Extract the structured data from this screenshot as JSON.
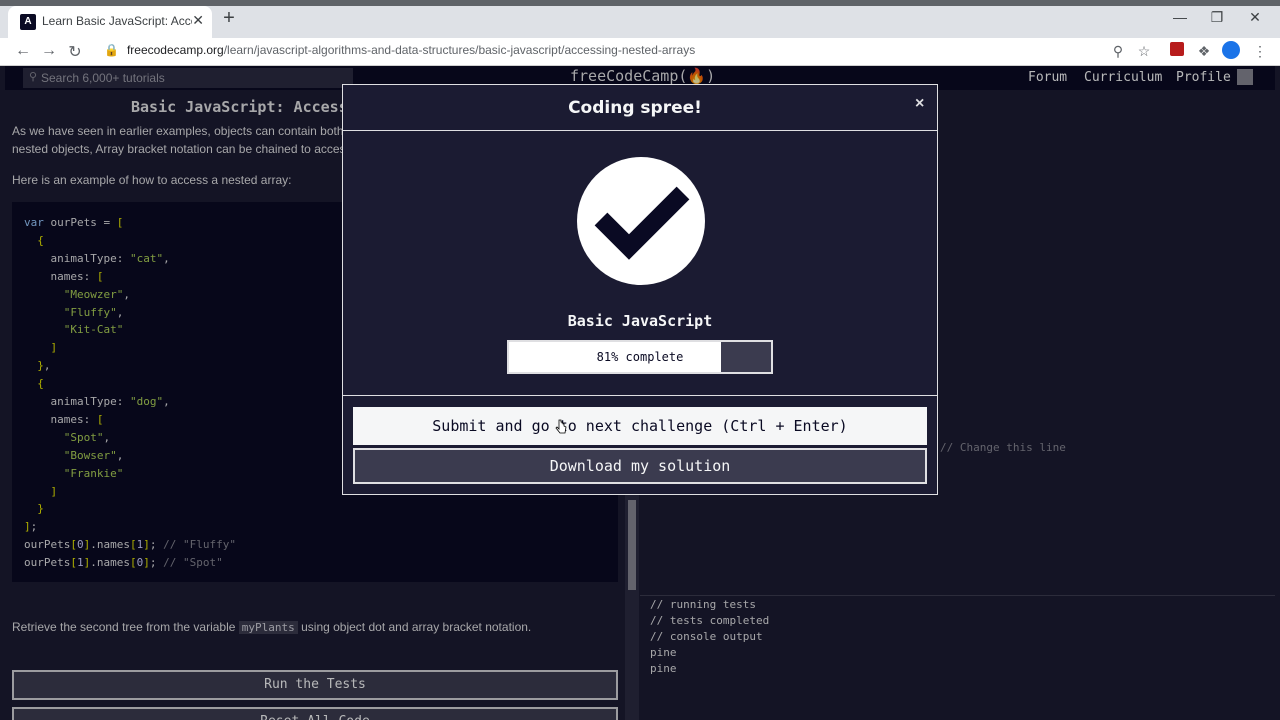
{
  "browser": {
    "tab_title": "Learn Basic JavaScript: Accessing",
    "tab_close": "✕",
    "new_tab": "+",
    "url_host": "freecodecamp.org",
    "url_path": "/learn/javascript-algorithms-and-data-structures/basic-javascript/accessing-nested-arrays"
  },
  "nav": {
    "search_placeholder": "Search 6,000+ tutorials",
    "logo": "freeCodeCamp(🔥)",
    "links": [
      "Forum",
      "Curriculum",
      "Profile"
    ]
  },
  "lesson": {
    "title": "Basic JavaScript: Access",
    "intro_line1": "As we have seen in earlier examples, objects can contain both ne",
    "intro_line2": "nested objects, Array bracket notation can be chained to access",
    "example_intro": "Here is an example of how to access a nested array:",
    "code": [
      [
        {
          "t": "kw",
          "v": "var"
        },
        {
          "t": "",
          "v": " ourPets = "
        },
        {
          "t": "pun",
          "v": "["
        }
      ],
      [
        {
          "t": "",
          "v": "  "
        },
        {
          "t": "pun",
          "v": "{"
        }
      ],
      [
        {
          "t": "",
          "v": "    animalType: "
        },
        {
          "t": "str",
          "v": "\"cat\""
        },
        {
          "t": "",
          "v": ","
        }
      ],
      [
        {
          "t": "",
          "v": "    names: "
        },
        {
          "t": "pun",
          "v": "["
        }
      ],
      [
        {
          "t": "",
          "v": "      "
        },
        {
          "t": "str",
          "v": "\"Meowzer\""
        },
        {
          "t": "",
          "v": ","
        }
      ],
      [
        {
          "t": "",
          "v": "      "
        },
        {
          "t": "str",
          "v": "\"Fluffy\""
        },
        {
          "t": "",
          "v": ","
        }
      ],
      [
        {
          "t": "",
          "v": "      "
        },
        {
          "t": "str",
          "v": "\"Kit-Cat\""
        }
      ],
      [
        {
          "t": "",
          "v": "    "
        },
        {
          "t": "pun",
          "v": "]"
        }
      ],
      [
        {
          "t": "",
          "v": "  "
        },
        {
          "t": "pun",
          "v": "}"
        },
        {
          "t": "",
          "v": ","
        }
      ],
      [
        {
          "t": "",
          "v": "  "
        },
        {
          "t": "pun",
          "v": "{"
        }
      ],
      [
        {
          "t": "",
          "v": "    animalType: "
        },
        {
          "t": "str",
          "v": "\"dog\""
        },
        {
          "t": "",
          "v": ","
        }
      ],
      [
        {
          "t": "",
          "v": "    names: "
        },
        {
          "t": "pun",
          "v": "["
        }
      ],
      [
        {
          "t": "",
          "v": "      "
        },
        {
          "t": "str",
          "v": "\"Spot\""
        },
        {
          "t": "",
          "v": ","
        }
      ],
      [
        {
          "t": "",
          "v": "      "
        },
        {
          "t": "str",
          "v": "\"Bowser\""
        },
        {
          "t": "",
          "v": ","
        }
      ],
      [
        {
          "t": "",
          "v": "      "
        },
        {
          "t": "str",
          "v": "\"Frankie\""
        }
      ],
      [
        {
          "t": "",
          "v": "    "
        },
        {
          "t": "pun",
          "v": "]"
        }
      ],
      [
        {
          "t": "",
          "v": "  "
        },
        {
          "t": "pun",
          "v": "}"
        }
      ],
      [
        {
          "t": "pun",
          "v": "]"
        },
        {
          "t": "",
          "v": ";"
        }
      ],
      [
        {
          "t": "",
          "v": "ourPets"
        },
        {
          "t": "pun",
          "v": "["
        },
        {
          "t": "num",
          "v": "0"
        },
        {
          "t": "pun",
          "v": "]"
        },
        {
          "t": "",
          "v": ".names"
        },
        {
          "t": "pun",
          "v": "["
        },
        {
          "t": "num",
          "v": "1"
        },
        {
          "t": "pun",
          "v": "]"
        },
        {
          "t": "",
          "v": "; "
        },
        {
          "t": "cmt",
          "v": "// \"Fluffy\""
        }
      ],
      [
        {
          "t": "",
          "v": "ourPets"
        },
        {
          "t": "pun",
          "v": "["
        },
        {
          "t": "num",
          "v": "1"
        },
        {
          "t": "pun",
          "v": "]"
        },
        {
          "t": "",
          "v": ".names"
        },
        {
          "t": "pun",
          "v": "["
        },
        {
          "t": "num",
          "v": "0"
        },
        {
          "t": "pun",
          "v": "]"
        },
        {
          "t": "",
          "v": "; "
        },
        {
          "t": "cmt",
          "v": "// \"Spot\""
        }
      ]
    ],
    "task_before": "Retrieve the second tree from the variable ",
    "task_code": "myPlants",
    "task_after": " using object dot and array bracket notation.",
    "run_tests": "Run the Tests",
    "reset_code": "Reset All Code"
  },
  "editor": {
    "comment": "// Change this line"
  },
  "console": {
    "lines": [
      "// running tests",
      "// tests completed",
      "// console output",
      "pine",
      "pine"
    ]
  },
  "modal": {
    "title": "Coding spree!",
    "close": "×",
    "block_name": "Basic JavaScript",
    "progress_percent": 81,
    "progress_text": "81% complete",
    "submit_button": "Submit and go to next challenge (Ctrl + Enter)",
    "download_button": "Download my solution"
  },
  "colors": {
    "bg": "#1b1b32",
    "nav_bg": "#0a0a23",
    "button_bg": "#3b3b4f",
    "text": "#dfdfe2"
  }
}
